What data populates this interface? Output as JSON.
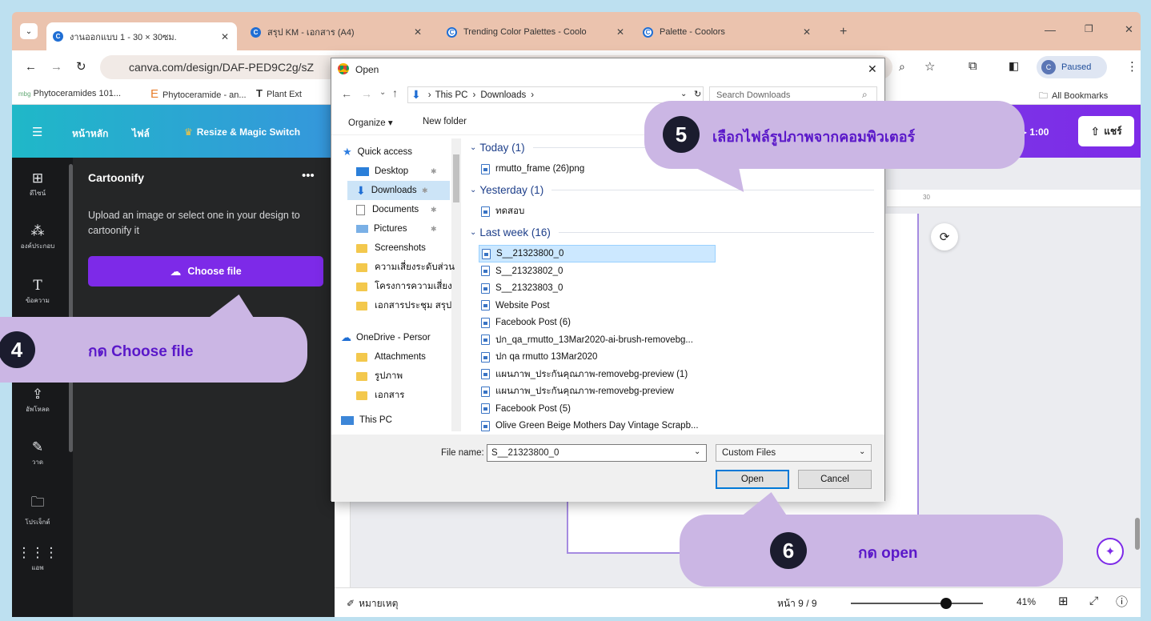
{
  "browser": {
    "tabs": [
      {
        "label": "งานออกแบบ 1 - 30 × 30ซม."
      },
      {
        "label": "สรุป KM - เอกสาร (A4)"
      },
      {
        "label": "Trending Color Palettes - Coolo"
      },
      {
        "label": "Palette - Coolors"
      }
    ],
    "url": "canva.com/design/DAF-PED9C2g/sZ",
    "paused_label": "Paused",
    "profile_initial": "C",
    "bookmarks": [
      "Phytoceramides 101...",
      "Phytoceramide - an...",
      "Plant Ext"
    ],
    "all_bookmarks_label": "All Bookmarks"
  },
  "canva": {
    "topbar": {
      "home": "หน้าหลัก",
      "file": "ไฟล์",
      "resize": "Resize & Magic Switch",
      "timer": "1:00",
      "share": "แชร์"
    },
    "rail": [
      {
        "label": "ดีไซน์",
        "icon": "layout-icon"
      },
      {
        "label": "องค์ประกอบ",
        "icon": "elements-icon"
      },
      {
        "label": "ข้อความ",
        "icon": "text-icon"
      },
      {
        "label": "อัพโหลด",
        "icon": "upload-icon"
      },
      {
        "label": "วาด",
        "icon": "draw-icon"
      },
      {
        "label": "โปรเจ็กต์",
        "icon": "folder-icon"
      },
      {
        "label": "แอพ",
        "icon": "apps-icon"
      }
    ],
    "panel": {
      "title": "Cartoonify",
      "description": "Upload an image or select one in your design to cartoonify it",
      "choose_file": "Choose file"
    },
    "ruler_label": "30",
    "bottom": {
      "notes": "หมายเหตุ",
      "page": "หน้า 9 / 9",
      "zoom": "41%",
      "zoom_level": 0.72
    }
  },
  "dialog": {
    "title": "Open",
    "path": [
      "This PC",
      "Downloads"
    ],
    "search_placeholder": "Search Downloads",
    "organize": "Organize",
    "new_folder": "New folder",
    "nav": [
      {
        "label": "Quick access",
        "type": "star"
      },
      {
        "label": "Desktop",
        "type": "blue"
      },
      {
        "label": "Downloads",
        "type": "download"
      },
      {
        "label": "Documents",
        "type": "doc"
      },
      {
        "label": "Pictures",
        "type": "pic"
      },
      {
        "label": "Screenshots",
        "type": "folder"
      },
      {
        "label": "ความเสี่ยงระดับส่วน",
        "type": "folder"
      },
      {
        "label": "โครงการความเสี่ยง",
        "type": "folder"
      },
      {
        "label": "เอกสารประชุม สรุป",
        "type": "folder"
      },
      {
        "label": "OneDrive - Persor",
        "type": "cloud"
      },
      {
        "label": "Attachments",
        "type": "folder"
      },
      {
        "label": "รูปภาพ",
        "type": "folder"
      },
      {
        "label": "เอกสาร",
        "type": "folder"
      },
      {
        "label": "This PC",
        "type": "pc"
      }
    ],
    "groups": [
      {
        "label": "Today (1)",
        "files": [
          "rmutto_frame (26)png"
        ]
      },
      {
        "label": "Yesterday (1)",
        "files": [
          "ทดสอบ"
        ]
      },
      {
        "label": "Last week (16)",
        "files": [
          "S__21323800_0",
          "S__21323802_0",
          "S__21323803_0",
          "Website Post",
          "Facebook Post (6)",
          "ปก_qa_rmutto_13Mar2020-ai-brush-removebg...",
          "ปก qa rmutto 13Mar2020",
          "แผนภาพ_ประกันคุณภาพ-removebg-preview (1)",
          "แผนภาพ_ประกันคุณภาพ-removebg-preview",
          "Facebook Post (5)",
          "Olive Green Beige Mothers Day Vintage Scrapb..."
        ]
      }
    ],
    "filename_label": "File name:",
    "filename_value": "S__21323800_0",
    "filter": "Custom Files",
    "open": "Open",
    "cancel": "Cancel"
  },
  "callouts": [
    {
      "num": "4",
      "text": "กด Choose file"
    },
    {
      "num": "5",
      "text": "เลือกไฟล์รูปภาพจากคอมพิวเตอร์"
    },
    {
      "num": "6",
      "text": "กด open"
    }
  ]
}
